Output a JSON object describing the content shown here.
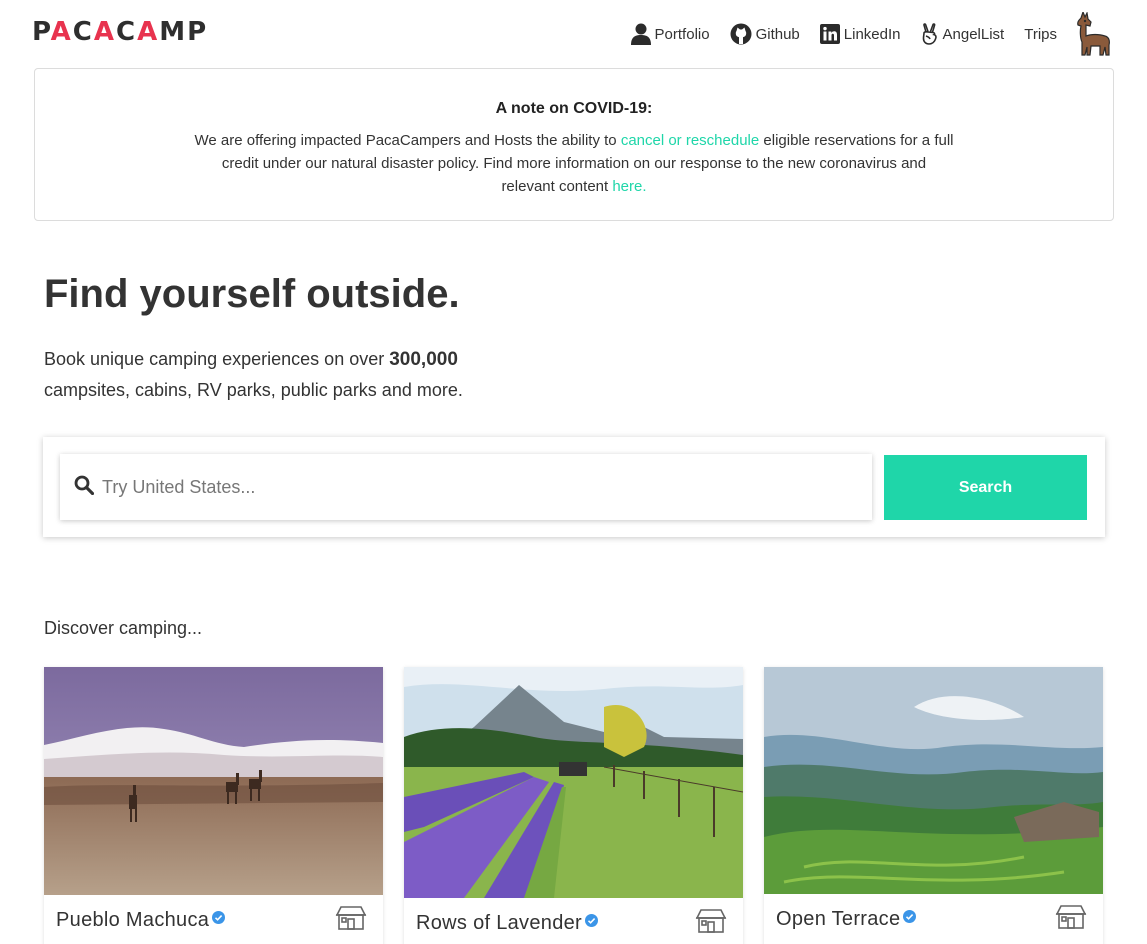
{
  "header": {
    "logo": "PACACAMP",
    "nav": [
      {
        "label": "Portfolio",
        "icon": "user-icon"
      },
      {
        "label": "Github",
        "icon": "github-icon"
      },
      {
        "label": "LinkedIn",
        "icon": "linkedin-icon"
      },
      {
        "label": "AngelList",
        "icon": "angellist-icon"
      },
      {
        "label": "Trips",
        "icon": ""
      }
    ],
    "avatar": "llama-avatar"
  },
  "covid": {
    "title": "A note on COVID-19:",
    "text_1": "We are offering impacted PacaCampers and Hosts the ability to ",
    "link_1": "cancel or reschedule",
    "text_2": " eligible reservations for a full credit under our natural disaster policy. Find more information on our response to the new coronavirus and relevant content ",
    "link_2": "here."
  },
  "hero": {
    "title": "Find yourself outside.",
    "subtitle_pre": "Book unique camping experiences on over ",
    "subtitle_count": "300,000",
    "subtitle_post": " campsites, cabins, RV parks, public parks and more."
  },
  "search": {
    "placeholder": "Try United States...",
    "value": "",
    "button_label": "Search"
  },
  "discover": {
    "heading": "Discover camping...",
    "cards": [
      {
        "name": "Pueblo Machuca",
        "verified": true,
        "type_icon": "cabin-icon"
      },
      {
        "name": "Rows of Lavender",
        "verified": true,
        "type_icon": "cabin-icon"
      },
      {
        "name": "Open Terrace",
        "verified": true,
        "type_icon": "cabin-icon"
      }
    ]
  },
  "colors": {
    "accent": "#1fd6a9",
    "logo_accent": "#e8334e",
    "text": "#333333",
    "verified": "#3b95e8"
  }
}
